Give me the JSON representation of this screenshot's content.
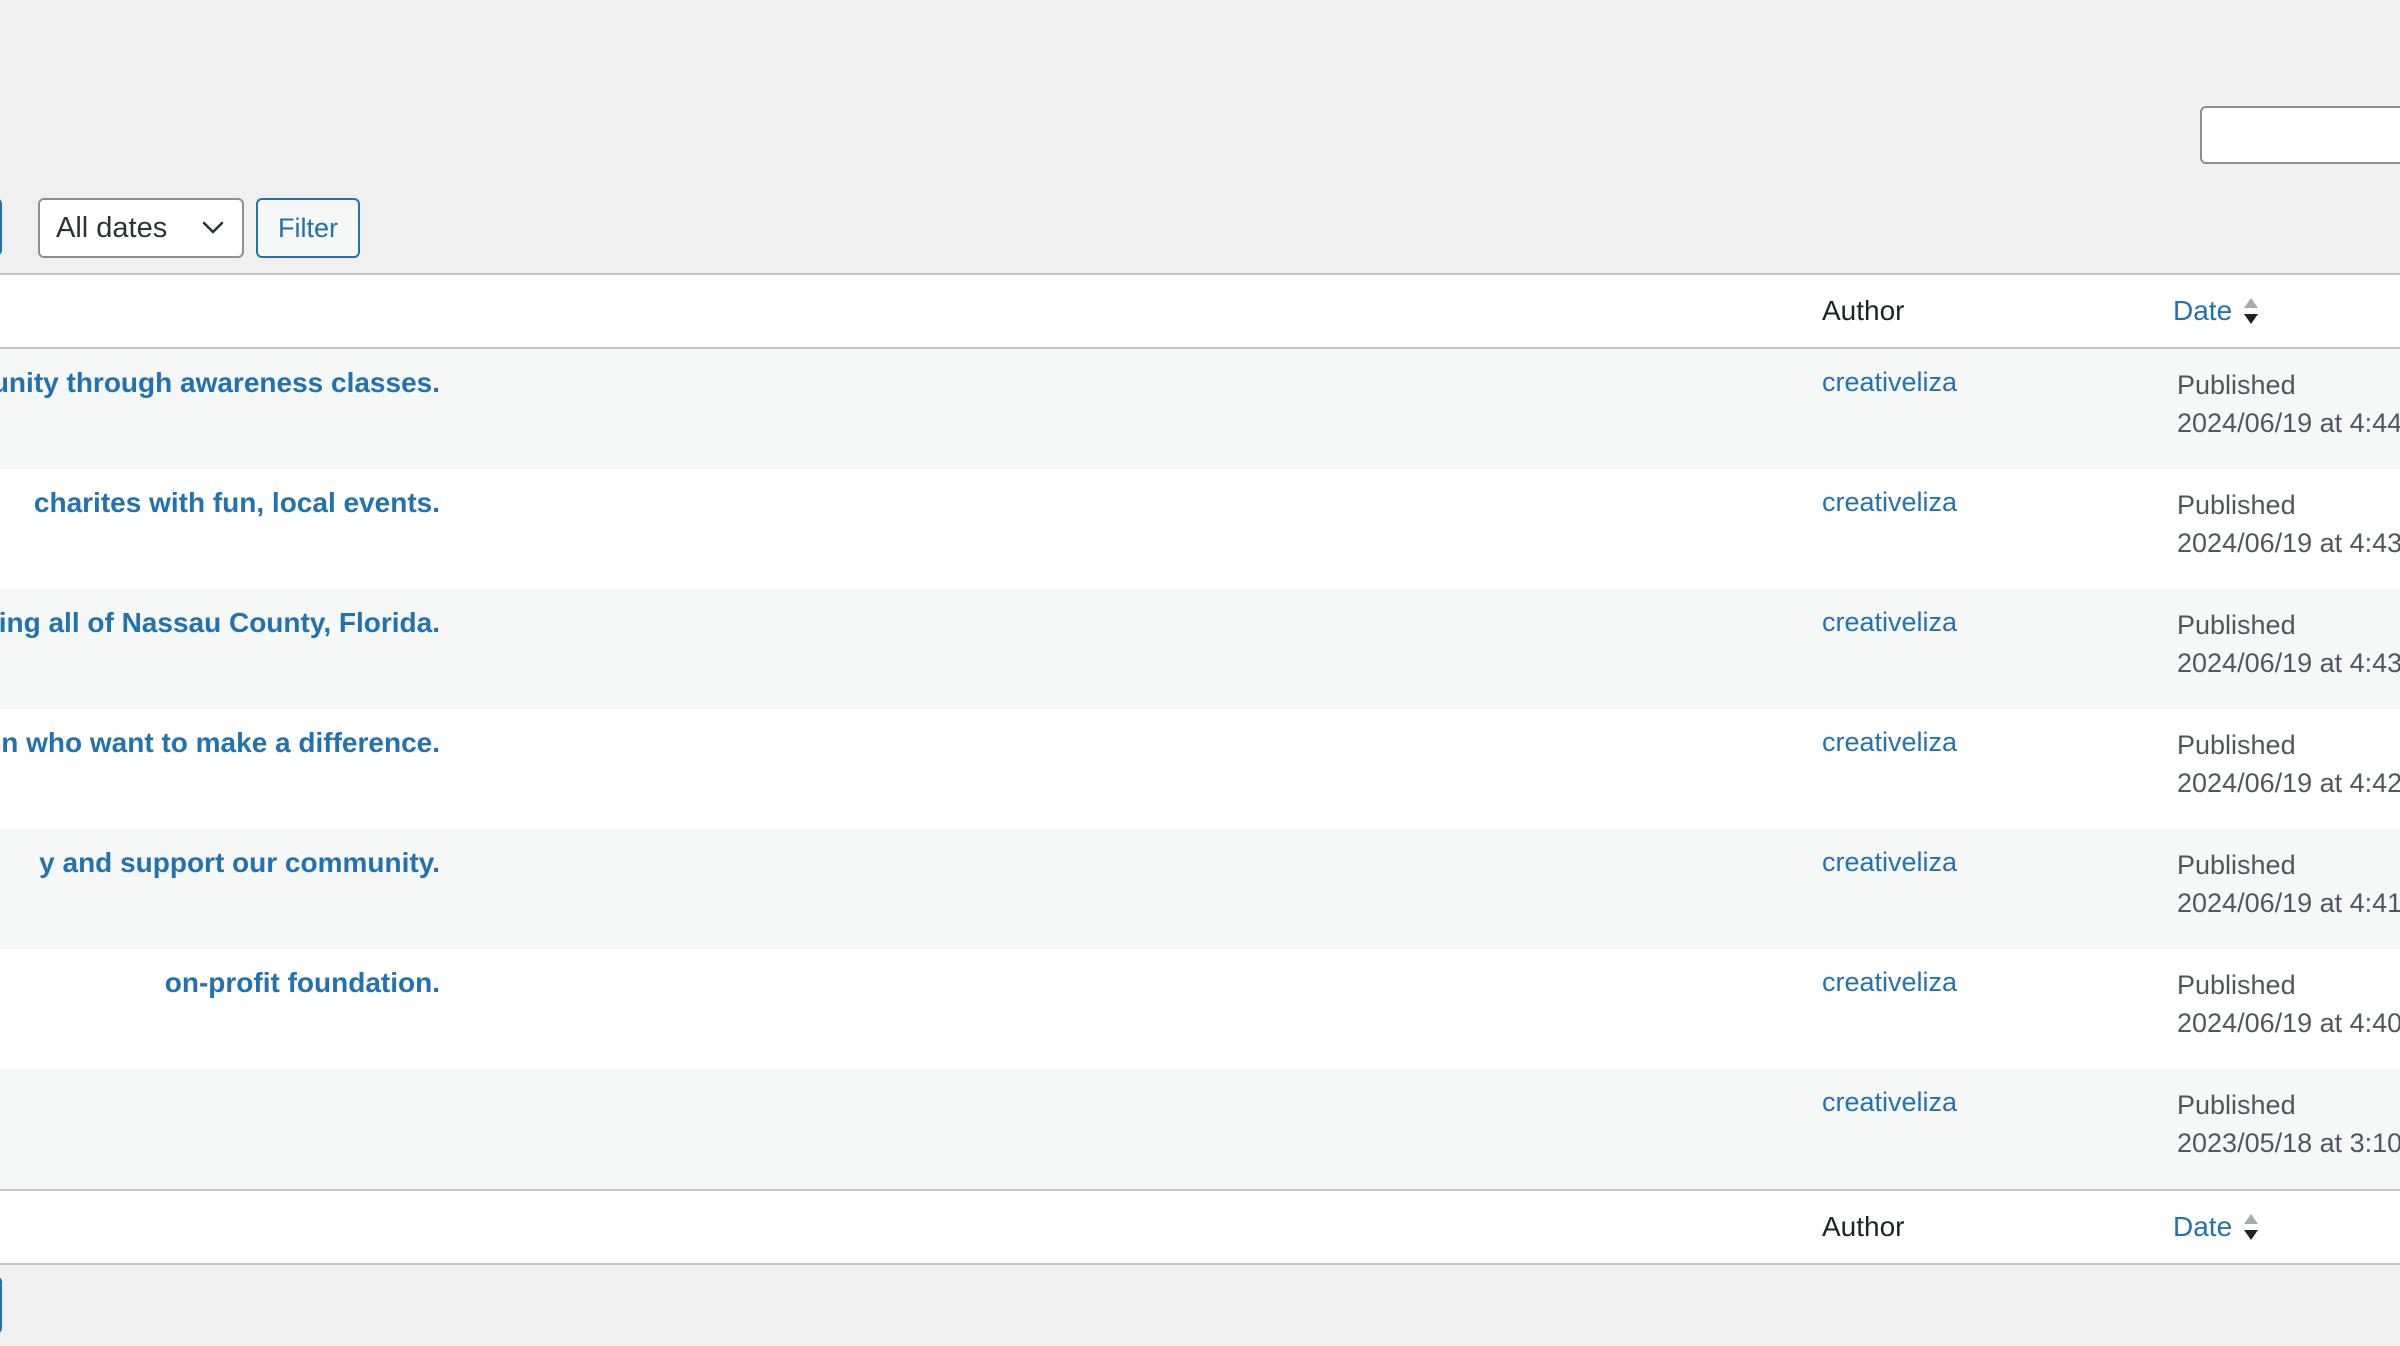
{
  "search": {
    "value": "",
    "placeholder": ""
  },
  "filters": {
    "date_selected": "All dates",
    "filter_label": "Filter"
  },
  "columns": {
    "author": "Author",
    "date": "Date"
  },
  "rows": [
    {
      "title": "unity through awareness classes.",
      "author": "creativeliza",
      "status": "Published",
      "datetime": "2024/06/19 at 4:44"
    },
    {
      "title": "charites with fun, local events.",
      "author": "creativeliza",
      "status": "Published",
      "datetime": "2024/06/19 at 4:43"
    },
    {
      "title": "d, supporting all of Nassau County, Florida.",
      "author": "creativeliza",
      "status": "Published",
      "datetime": "2024/06/19 at 4:43"
    },
    {
      "title": "nen who want to make a difference.",
      "author": "creativeliza",
      "status": "Published",
      "datetime": "2024/06/19 at 4:42"
    },
    {
      "title": "y and support our community.",
      "author": "creativeliza",
      "status": "Published",
      "datetime": "2024/06/19 at 4:41"
    },
    {
      "title": "on-profit foundation.",
      "author": "creativeliza",
      "status": "Published",
      "datetime": "2024/06/19 at 4:40"
    },
    {
      "title": "",
      "author": "creativeliza",
      "status": "Published",
      "datetime": "2023/05/18 at 3:10"
    }
  ],
  "colors": {
    "link": "#2271b1",
    "background": "#f0f0f1",
    "row_alt": "#f6f7f7",
    "border": "#c3c4c7"
  },
  "icons": {
    "select_arrow": "chevron-down-icon",
    "sort": "sort-arrows-icon"
  }
}
